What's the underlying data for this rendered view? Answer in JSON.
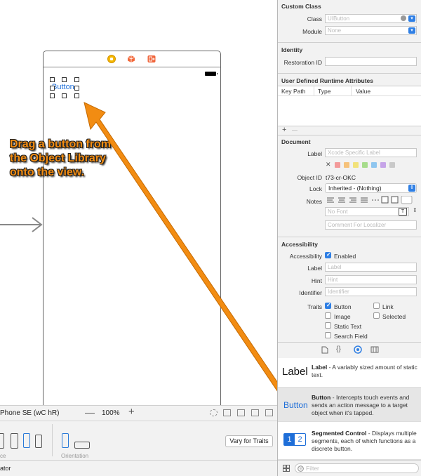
{
  "canvas": {
    "button_text": "Button",
    "instruction": "Drag a button from the Object Library onto the view."
  },
  "bottom_bar": {
    "device": "Phone SE (wC hR)",
    "zoom_minus": "—",
    "zoom_level": "100%",
    "zoom_plus": "+",
    "left_label": "ce",
    "orientation_label": "Orientation",
    "vary_button": "Vary for Traits",
    "status": "ator"
  },
  "inspector": {
    "custom_class": {
      "title": "Custom Class",
      "class_label": "Class",
      "class_placeholder": "UIButton",
      "module_label": "Module",
      "module_placeholder": "None"
    },
    "identity": {
      "title": "Identity",
      "restoration_label": "Restoration ID"
    },
    "runtime_attrs": {
      "title": "User Defined Runtime Attributes",
      "col_keypath": "Key Path",
      "col_type": "Type",
      "col_value": "Value",
      "add": "+",
      "remove": "—"
    },
    "document": {
      "title": "Document",
      "label_label": "Label",
      "label_placeholder": "Xcode Specific Label",
      "remove_mark": "✕",
      "object_id_label": "Object ID",
      "object_id_value": "t73-cr-OKC",
      "lock_label": "Lock",
      "lock_value": "Inherited - (Nothing)",
      "notes_label": "Notes",
      "font_placeholder": "No Font",
      "comment_placeholder": "Comment For Localizer",
      "swatch_colors": [
        "#f39a9a",
        "#f6c27b",
        "#f2e27a",
        "#a7dc8c",
        "#8fc6ef",
        "#c6a4e8",
        "#c9c9c9"
      ]
    },
    "accessibility": {
      "title": "Accessibility",
      "accessibility_label": "Accessibility",
      "enabled_label": "Enabled",
      "label_label": "Label",
      "label_placeholder": "Label",
      "hint_label": "Hint",
      "hint_placeholder": "Hint",
      "identifier_label": "Identifier",
      "identifier_placeholder": "Identifier",
      "traits_label": "Traits",
      "traits": {
        "button": "Button",
        "link": "Link",
        "image": "Image",
        "selected": "Selected",
        "static_text": "Static Text",
        "search_field": "Search Field"
      }
    },
    "library": {
      "items": [
        {
          "icon": "Label",
          "title": "Label",
          "desc": " - A variably sized amount of static text."
        },
        {
          "icon": "Button",
          "title": "Button",
          "desc": " - Intercepts touch events and sends an action message to a target object when it's tapped."
        },
        {
          "icon_1": "1",
          "icon_2": "2",
          "title": "Segmented Control",
          "desc": " - Displays multiple segments, each of which functions as a discrete button."
        }
      ],
      "filter_placeholder": "Filter"
    },
    "accent_color": "#2f7fe4"
  }
}
